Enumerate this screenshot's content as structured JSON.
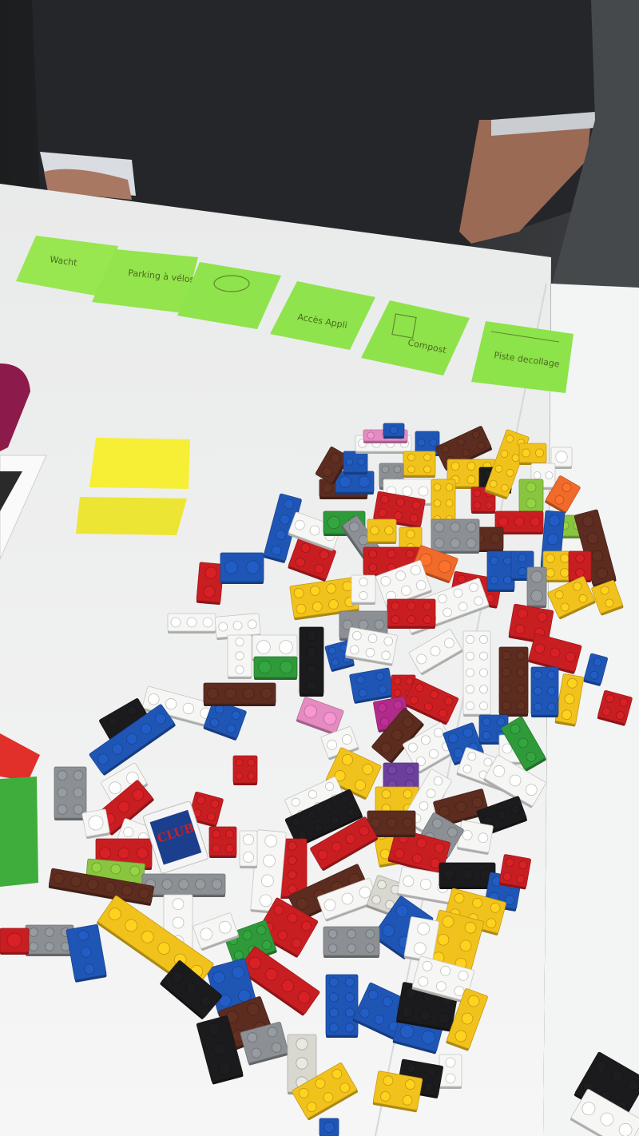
{
  "sticky_notes": [
    {
      "text": "Wacht"
    },
    {
      "text": "Parking à vélos"
    },
    {
      "text": ""
    },
    {
      "text": "Accès Appli"
    },
    {
      "text": "Compost"
    },
    {
      "text": "Piste decollage"
    }
  ],
  "brick_print": {
    "text": "CLUB"
  },
  "colors": {
    "table": "#f2f3f3",
    "shirt": "#27282a",
    "sticky_green": "#8fe34d",
    "sticky_yellow": "#f3ee39",
    "red": "#c81e22",
    "blue": "#1f56b6",
    "yellow": "#f2c21c",
    "white": "#f6f6f4",
    "black": "#1b1b1d",
    "green": "#2f9a3a",
    "brown": "#5b2c1f",
    "gray": "#8c9094"
  }
}
